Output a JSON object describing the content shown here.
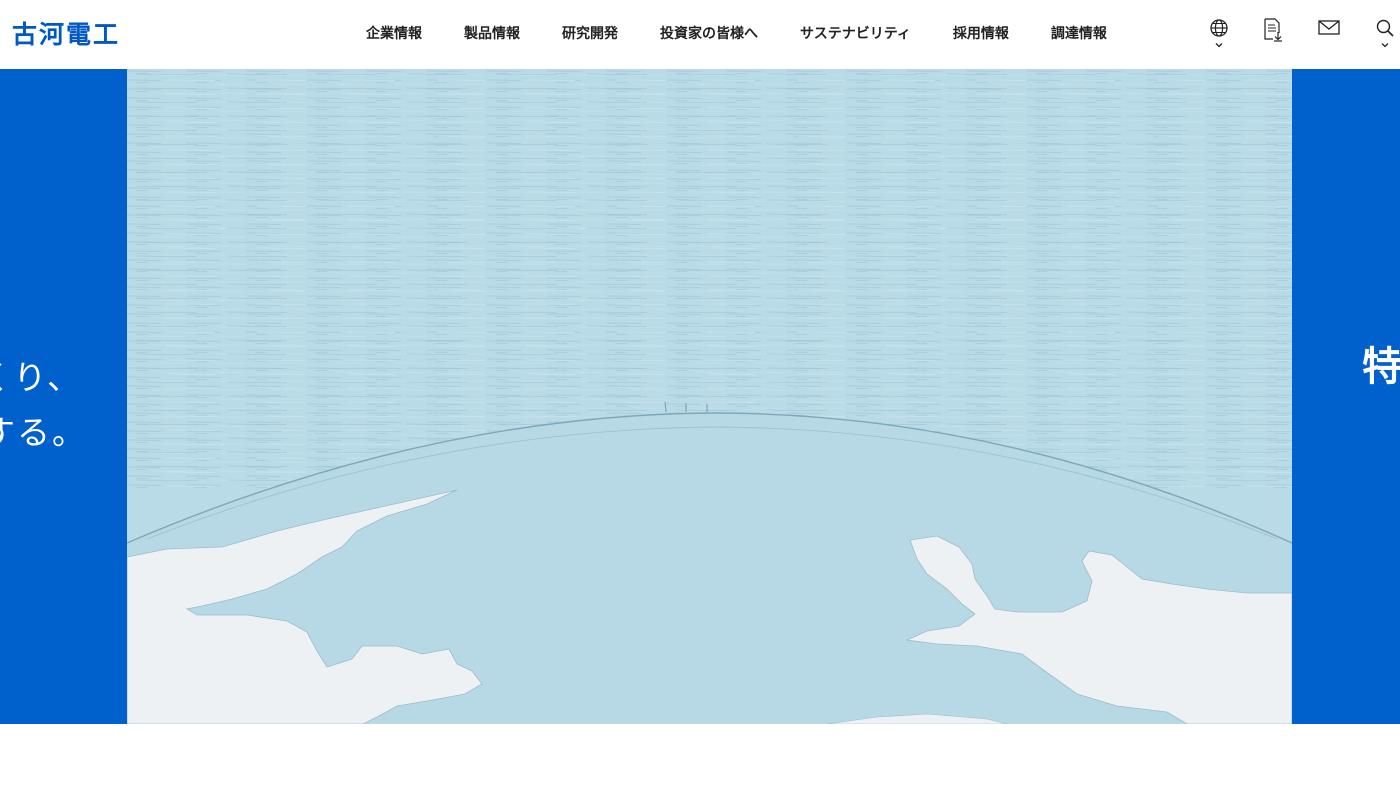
{
  "header": {
    "logo_text": "古河電工",
    "nav": [
      "企業情報",
      "製品情報",
      "研究開発",
      "投資家の皆様へ",
      "サステナビリティ",
      "採用情報",
      "調達情報"
    ],
    "tools": {
      "language_icon": "globe-icon",
      "document_icon": "document-download-icon",
      "contact_icon": "mail-icon",
      "search_icon": "search-icon"
    }
  },
  "hero": {
    "left_panel": {
      "line1": "つくり、",
      "line2": "する。"
    },
    "right_panel": {
      "partial_text": "特"
    }
  },
  "colors": {
    "brand_blue": "#0058c6",
    "panel_blue": "#0060cc",
    "sky": "#b8d9e6",
    "land": "#eef1f4"
  }
}
